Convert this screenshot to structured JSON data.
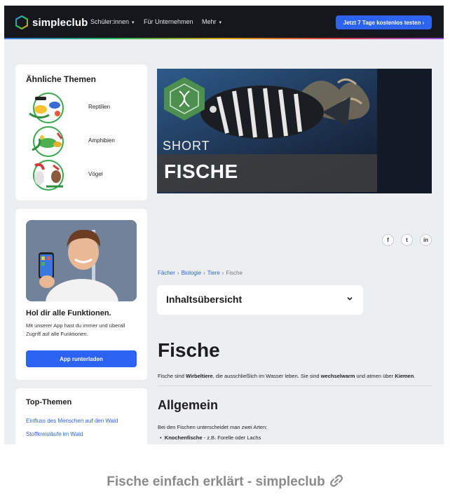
{
  "header": {
    "logo_text": "simpleclub",
    "nav": [
      {
        "label": "Schüler:innen",
        "dropdown": true
      },
      {
        "label": "Für Unternehmen",
        "dropdown": false
      },
      {
        "label": "Mehr",
        "dropdown": true
      }
    ],
    "cta_label": "Jetzt 7 Tage kostenlos testen ›",
    "accent_color": "#2d63f2"
  },
  "similar_topics": {
    "title": "Ähnliche Themen",
    "items": [
      {
        "label": "Reptilien",
        "icon": "reptiles-illustration"
      },
      {
        "label": "Amphibien",
        "icon": "amphibians-illustration"
      },
      {
        "label": "Vögel",
        "icon": "birds-illustration"
      }
    ]
  },
  "promo": {
    "title": "Hol dir alle Funktionen.",
    "text": "Mit unserer App hast du immer und überall Zugriff auf alle Funktionen.",
    "button": "App runterladen"
  },
  "top_topics": {
    "title": "Top-Themen",
    "links": [
      "Einfluss des Menschen auf den Wald",
      "Stoffkreisläufe im Wald"
    ]
  },
  "hero": {
    "tag": "SHORT",
    "title": "FISCHE",
    "badge_icon": "dna-icon"
  },
  "social": [
    "f",
    "t",
    "in"
  ],
  "breadcrumb": {
    "items": [
      "Fächer",
      "Biologie",
      "Tiere"
    ],
    "current": "Fische"
  },
  "toc": {
    "label": "Inhaltsübersicht"
  },
  "article": {
    "title": "Fische",
    "intro_parts": [
      {
        "text": "Fische sind ",
        "bold": false
      },
      {
        "text": "Wirbeltiere",
        "bold": true
      },
      {
        "text": ", die ausschließlich im Wasser leben. Sie sind ",
        "bold": false
      },
      {
        "text": "wechselwarm",
        "bold": true
      },
      {
        "text": " und atmen über ",
        "bold": false
      },
      {
        "text": "Kiemen",
        "bold": true
      },
      {
        "text": ".",
        "bold": false
      }
    ],
    "section_title": "Allgemein",
    "section_text": "Bei den Fischen unterscheidet man zwei Arten:",
    "bullet_bold": "Knochenfische",
    "bullet_rest": " - z.B. Forelle oder Lachs"
  },
  "caption": "Fische einfach erklärt - simpleclub"
}
